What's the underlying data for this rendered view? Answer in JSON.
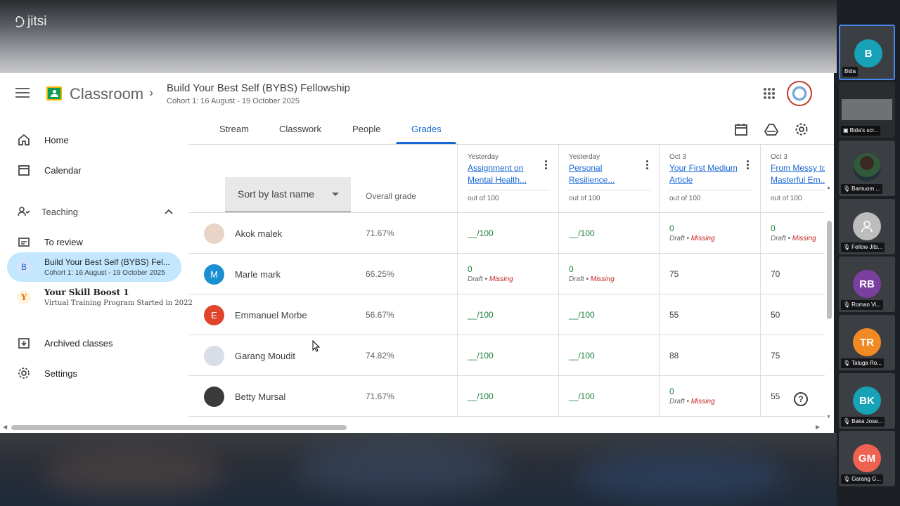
{
  "meeting": {
    "brand": "jitsi"
  },
  "topbar": {
    "app_title": "Classroom",
    "class_title": "Build Your Best Self (BYBS) Fellowship",
    "class_subtitle": "Cohort 1: 16 August - 19 October 2025"
  },
  "sidebar": {
    "home": "Home",
    "calendar": "Calendar",
    "teaching": "Teaching",
    "to_review": "To review",
    "classes": [
      {
        "badge": "B",
        "name": "Build Your Best Self (BYBS) Fel...",
        "meta": "Cohort 1: 16 August - 19 October 2025"
      },
      {
        "badge": "Y",
        "name": "Your Skill Boost 1",
        "meta": "Virtual Training Program Started in 2022"
      }
    ],
    "archived": "Archived classes",
    "settings": "Settings"
  },
  "tabs": [
    "Stream",
    "Classwork",
    "People",
    "Grades"
  ],
  "active_tab": "Grades",
  "grades": {
    "sort_label": "Sort by last name",
    "overall_header": "Overall grade",
    "columns": [
      {
        "date": "Yesterday",
        "title": "Assignment on Mental Health...",
        "out_of": "out of 100"
      },
      {
        "date": "Yesterday",
        "title": "Personal Resilience...",
        "out_of": "out of 100"
      },
      {
        "date": "Oct 3",
        "title": "Your First Medium Article",
        "out_of": "out of 100"
      },
      {
        "date": "Oct 3",
        "title": "From Messy to Masterful Em...",
        "out_of": "out of 100"
      }
    ],
    "rows": [
      {
        "name": "Akok malek",
        "overall": "71.67%",
        "avatar_color": "#e8d5c8",
        "avatar_letter": "",
        "cells": [
          {
            "type": "empty",
            "text": "__/100"
          },
          {
            "type": "empty",
            "text": "__/100"
          },
          {
            "type": "missing",
            "score": "0",
            "draft": "Draft",
            "missing": "Missing"
          },
          {
            "type": "missing",
            "score": "0",
            "draft": "Draft",
            "missing": "Missing"
          }
        ]
      },
      {
        "name": "Marle mark",
        "overall": "66.25%",
        "avatar_color": "#1a8fd1",
        "avatar_letter": "M",
        "cells": [
          {
            "type": "missing",
            "score": "0",
            "draft": "Draft",
            "missing": "Missing"
          },
          {
            "type": "missing",
            "score": "0",
            "draft": "Draft",
            "missing": "Missing"
          },
          {
            "type": "score",
            "text": "75"
          },
          {
            "type": "score",
            "text": "70"
          }
        ]
      },
      {
        "name": "Emmanuel Morbe",
        "overall": "56.67%",
        "avatar_color": "#e0442b",
        "avatar_letter": "E",
        "cells": [
          {
            "type": "empty",
            "text": "__/100"
          },
          {
            "type": "empty",
            "text": "__/100"
          },
          {
            "type": "score",
            "text": "55"
          },
          {
            "type": "score",
            "text": "50"
          }
        ]
      },
      {
        "name": "Garang Moudit",
        "overall": "74.82%",
        "avatar_color": "#d8dde6",
        "avatar_letter": "",
        "cells": [
          {
            "type": "empty",
            "text": "__/100"
          },
          {
            "type": "empty",
            "text": "__/100"
          },
          {
            "type": "score",
            "text": "88"
          },
          {
            "type": "score",
            "text": "75"
          }
        ]
      },
      {
        "name": "Betty Mursal",
        "overall": "71.67%",
        "avatar_color": "#3a3a3a",
        "avatar_letter": "",
        "cells": [
          {
            "type": "empty",
            "text": "__/100"
          },
          {
            "type": "empty",
            "text": "__/100"
          },
          {
            "type": "missing",
            "score": "0",
            "draft": "Draft",
            "missing": "Missing"
          },
          {
            "type": "score",
            "text": "55"
          }
        ]
      }
    ]
  },
  "participants": [
    {
      "initials": "B",
      "name": "Bida",
      "color": "#17a2b8",
      "icon": "none"
    },
    {
      "initials": "",
      "name": "Bida's scr...",
      "color": "#222",
      "icon": "screen-share-icon"
    },
    {
      "initials": "",
      "name": "Bamuom ...",
      "color": "#4a4e55",
      "icon": "mic-off-icon"
    },
    {
      "initials": "",
      "name": "Fellow Jits...",
      "color": "#bdbdbd",
      "icon": "mic-off-icon"
    },
    {
      "initials": "RB",
      "name": "Roman Vi...",
      "color": "#7b3fa0",
      "icon": "mic-off-icon"
    },
    {
      "initials": "TR",
      "name": "Taluga Ro...",
      "color": "#f08a24",
      "icon": "mic-off-icon"
    },
    {
      "initials": "BK",
      "name": "Baka Jose...",
      "color": "#17a2b8",
      "icon": "mic-off-icon"
    },
    {
      "initials": "GM",
      "name": "Garang G...",
      "color": "#ef6150",
      "icon": "mic-off-icon"
    }
  ]
}
